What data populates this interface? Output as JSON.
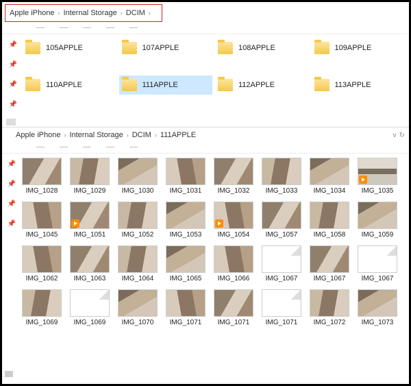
{
  "top": {
    "breadcrumb": [
      "Apple iPhone",
      "Internal Storage",
      "DCIM"
    ],
    "folders": [
      {
        "name": "105APPLE",
        "selected": false
      },
      {
        "name": "107APPLE",
        "selected": false
      },
      {
        "name": "108APPLE",
        "selected": false
      },
      {
        "name": "109APPLE",
        "selected": false
      },
      {
        "name": "110APPLE",
        "selected": false
      },
      {
        "name": "111APPLE",
        "selected": true
      },
      {
        "name": "112APPLE",
        "selected": false
      },
      {
        "name": "113APPLE",
        "selected": false
      }
    ]
  },
  "bottom": {
    "breadcrumb": [
      "Apple iPhone",
      "Internal Storage",
      "DCIM",
      "111APPLE"
    ],
    "items": [
      {
        "name": "IMG_1028",
        "kind": "photo",
        "variant": "a"
      },
      {
        "name": "IMG_1029",
        "kind": "photo",
        "variant": "b"
      },
      {
        "name": "IMG_1030",
        "kind": "photo",
        "variant": "c"
      },
      {
        "name": "IMG_1031",
        "kind": "photo",
        "variant": "d"
      },
      {
        "name": "IMG_1032",
        "kind": "photo",
        "variant": "a"
      },
      {
        "name": "IMG_1033",
        "kind": "photo",
        "variant": "b"
      },
      {
        "name": "IMG_1034",
        "kind": "photo",
        "variant": "c"
      },
      {
        "name": "IMG_1035",
        "kind": "video",
        "variant": "storefront"
      },
      {
        "name": "IMG_1045",
        "kind": "photo",
        "variant": "d"
      },
      {
        "name": "IMG_1051",
        "kind": "video",
        "variant": "a"
      },
      {
        "name": "IMG_1052",
        "kind": "photo",
        "variant": "b"
      },
      {
        "name": "IMG_1053",
        "kind": "photo",
        "variant": "c"
      },
      {
        "name": "IMG_1054",
        "kind": "video",
        "variant": "d"
      },
      {
        "name": "IMG_1057",
        "kind": "photo",
        "variant": "a"
      },
      {
        "name": "IMG_1058",
        "kind": "photo",
        "variant": "b"
      },
      {
        "name": "IMG_1059",
        "kind": "photo",
        "variant": "c"
      },
      {
        "name": "IMG_1062",
        "kind": "photo",
        "variant": "d"
      },
      {
        "name": "IMG_1063",
        "kind": "photo",
        "variant": "a"
      },
      {
        "name": "IMG_1064",
        "kind": "photo",
        "variant": "b"
      },
      {
        "name": "IMG_1065",
        "kind": "photo",
        "variant": "c"
      },
      {
        "name": "IMG_1066",
        "kind": "photo",
        "variant": "d"
      },
      {
        "name": "IMG_1067",
        "kind": "blank"
      },
      {
        "name": "IMG_1067",
        "kind": "photo",
        "variant": "a"
      },
      {
        "name": "IMG_1067",
        "kind": "blank"
      },
      {
        "name": "IMG_1069",
        "kind": "photo",
        "variant": "b"
      },
      {
        "name": "IMG_1069",
        "kind": "blank"
      },
      {
        "name": "IMG_1070",
        "kind": "photo",
        "variant": "c"
      },
      {
        "name": "IMG_1071",
        "kind": "photo",
        "variant": "d"
      },
      {
        "name": "IMG_1071",
        "kind": "photo",
        "variant": "a"
      },
      {
        "name": "IMG_1071",
        "kind": "blank"
      },
      {
        "name": "IMG_1072",
        "kind": "photo",
        "variant": "b"
      },
      {
        "name": "IMG_1073",
        "kind": "photo",
        "variant": "c"
      }
    ]
  }
}
